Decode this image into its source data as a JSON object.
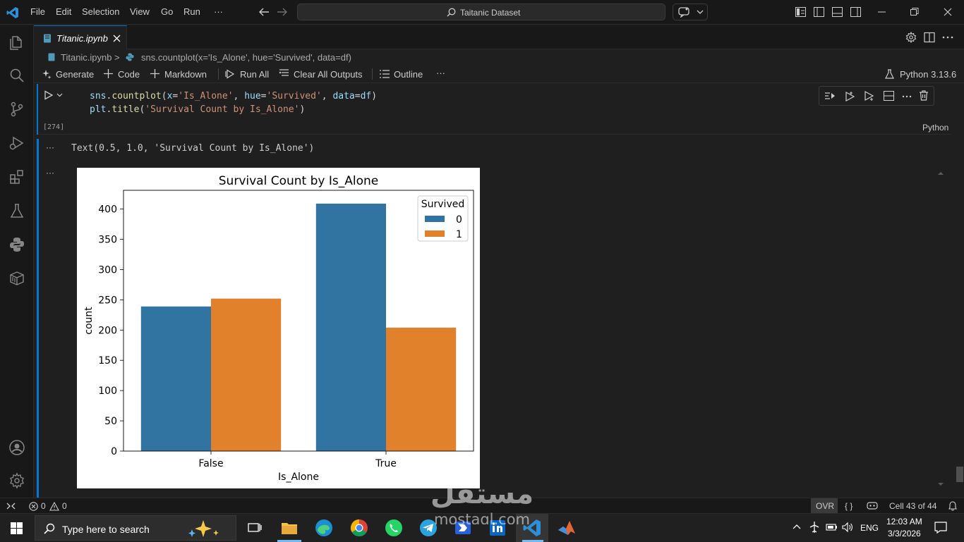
{
  "window": {
    "menu": [
      "File",
      "Edit",
      "Selection",
      "View",
      "Go",
      "Run",
      "···"
    ],
    "search_text": "Taitanic Dataset"
  },
  "tab": {
    "label": "Titanic.ipynb"
  },
  "breadcrumb": {
    "file": "Titanic.ipynb",
    "separator": ">",
    "symbol": "sns.countplot(x='Is_Alone', hue='Survived', data=df)"
  },
  "toolbar": {
    "generate": "Generate",
    "code": "Code",
    "markdown": "Markdown",
    "run_all": "Run All",
    "clear_outputs": "Clear All Outputs",
    "outline": "Outline",
    "more": "···",
    "kernel": "Python 3.13.6"
  },
  "cell": {
    "execution_count": "[274]",
    "language": "Python",
    "line1": {
      "obj": "sns",
      "dot": ".",
      "fn": "countplot",
      "open": "(",
      "p1": "x",
      "eq": "=",
      "s1": "'Is_Alone'",
      "comma": ", ",
      "p2": "hue",
      "s2": "'Survived'",
      "p3": "data",
      "v3": "df",
      "close": ")"
    },
    "line2": {
      "obj": "plt",
      "dot": ".",
      "fn": "title",
      "open": "(",
      "s1": "'Survival Count by Is_Alone'",
      "close": ")"
    }
  },
  "output": {
    "ellipsis": "···",
    "text": "Text(0.5, 1.0, 'Survival Count by Is_Alone')"
  },
  "chart_data": {
    "type": "bar",
    "title": "Survival Count by Is_Alone",
    "xlabel": "Is_Alone",
    "ylabel": "count",
    "categories": [
      "False",
      "True"
    ],
    "series": [
      {
        "name": "0",
        "values": [
          239,
          409
        ],
        "color": "#3274a1"
      },
      {
        "name": "1",
        "values": [
          252,
          204
        ],
        "color": "#e1812c"
      }
    ],
    "ylim": [
      0,
      431
    ],
    "yticks": [
      0,
      50,
      100,
      150,
      200,
      250,
      300,
      350,
      400
    ],
    "legend": {
      "title": "Survived",
      "placement": "top-right"
    },
    "grid": false
  },
  "statusbar": {
    "errors": "0",
    "warnings": "0",
    "mode": "OVR",
    "braces": "{ }",
    "cell_position": "Cell 43 of 44"
  },
  "taskbar": {
    "search_placeholder": "Type here to search",
    "language": "ENG",
    "time": "12:03 AM",
    "date": "3/3/2026"
  },
  "watermark": {
    "arabic": "مستقل",
    "latin": "mostaql.com"
  }
}
